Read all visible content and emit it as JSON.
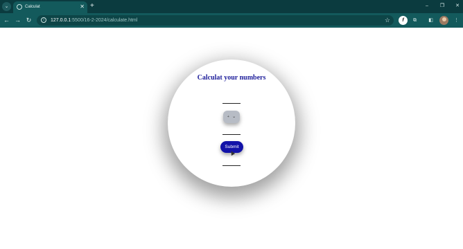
{
  "browser": {
    "tab_title": "Calculat",
    "tab_close": "✕",
    "new_tab": "+",
    "url_host": "127.0.0.1",
    "url_path": ":5500/16-2-2024/calculate.html",
    "extension_label": "f"
  },
  "window_controls": {
    "minimize": "–",
    "restore": "❐",
    "close": "✕"
  },
  "form": {
    "heading": "Calculat your numbers",
    "operator_value": "+ ",
    "operator_chevron": "⌄",
    "submit_label": "Submit"
  },
  "colors": {
    "chrome_dark": "#0b3b3f",
    "chrome_toolbar": "#135a5c",
    "heading": "#1d1d9a",
    "submit_bg": "#1212a8",
    "select_bg": "#b7bcc5"
  }
}
